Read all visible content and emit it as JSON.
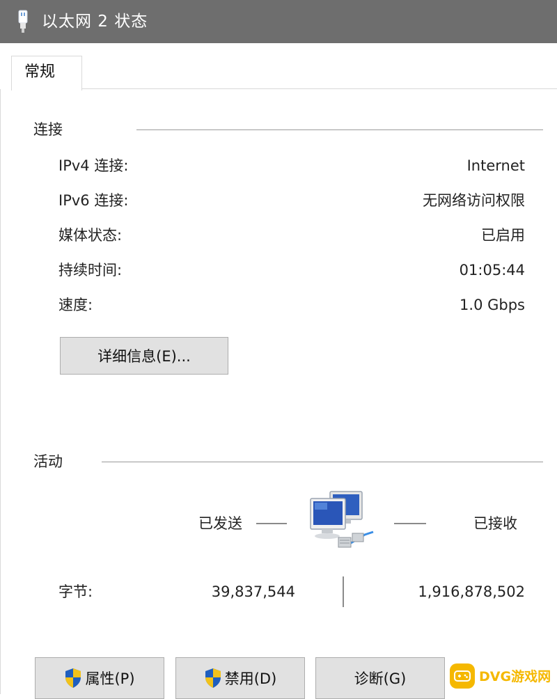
{
  "window": {
    "title": "以太网 2 状态"
  },
  "tabs": [
    {
      "label": "常规"
    }
  ],
  "connection": {
    "section_title": "连接",
    "rows": [
      {
        "label": "IPv4 连接:",
        "value": "Internet"
      },
      {
        "label": "IPv6 连接:",
        "value": "无网络访问权限"
      },
      {
        "label": "媒体状态:",
        "value": "已启用"
      },
      {
        "label": "持续时间:",
        "value": "01:05:44"
      },
      {
        "label": "速度:",
        "value": "1.0 Gbps"
      }
    ],
    "details_button": "详细信息(E)..."
  },
  "activity": {
    "section_title": "活动",
    "sent_label": "已发送",
    "received_label": "已接收",
    "bytes_label": "字节:",
    "bytes_sent": "39,837,544",
    "bytes_received": "1,916,878,502"
  },
  "buttons": {
    "properties": "属性(P)",
    "disable": "禁用(D)",
    "diagnose": "诊断(G)"
  },
  "watermark": {
    "text": "DVG游戏网"
  },
  "icons": {
    "title": "ethernet-plug-icon",
    "network": "network-computers-icon",
    "shield": "uac-shield-icon"
  },
  "colors": {
    "titlebar": "#6e6e6e",
    "button_face": "#e1e1e1",
    "watermark": "#f5b800"
  }
}
